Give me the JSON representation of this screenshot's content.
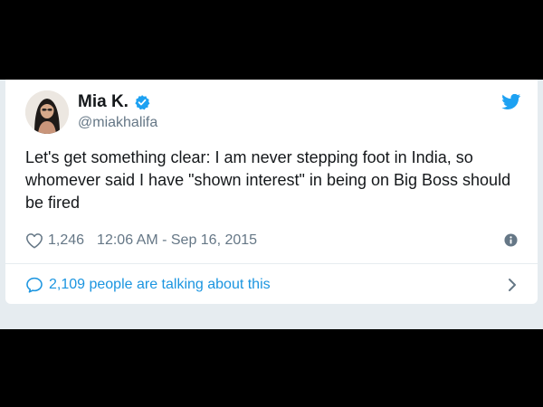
{
  "tweet": {
    "author_name": "Mia K.",
    "verified": true,
    "handle": "@miakhalifa",
    "text": "Let's get something clear: I am never stepping foot in India, so whomever said I have \"shown interest\" in being on Big Boss should be fired",
    "like_count": "1,246",
    "timestamp": "12:06 AM - Sep 16, 2015",
    "conversation_label": "2,109 people are talking about this"
  },
  "icons": {
    "brand": "twitter-bird-icon",
    "verified": "verified-badge-icon",
    "like": "heart-icon",
    "info": "info-icon",
    "reply": "speech-bubble-icon",
    "open": "chevron-right-icon"
  },
  "colors": {
    "twitter_blue": "#1da1f2",
    "link_blue": "#1b95e0",
    "text_primary": "#14171a",
    "text_secondary": "#657786",
    "page_background": "#e6ecf0",
    "card_background": "#ffffff",
    "letterbox": "#000000"
  }
}
